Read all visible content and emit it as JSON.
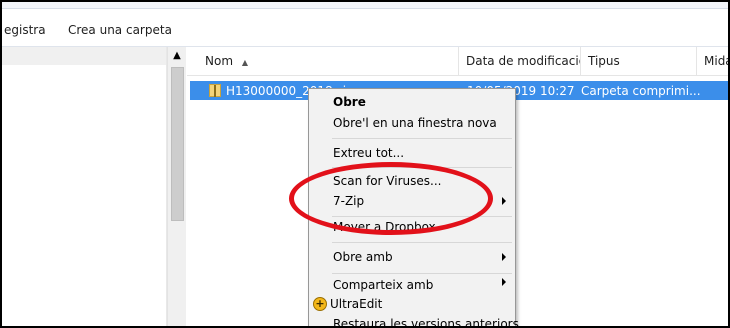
{
  "toolbar": {
    "items": [
      "egistra",
      "Crea una carpeta"
    ]
  },
  "scrollbar": {
    "up_arrow": "▲"
  },
  "columns": {
    "name": "Nom",
    "name_sort_icon": "▲",
    "date": "Data de modificació",
    "type": "Tipus",
    "size": "Mida"
  },
  "file": {
    "name": "H13000000_2018.zip",
    "date": "10/05/2019 10:27",
    "type": "Carpeta comprimi..."
  },
  "context_menu": {
    "open": "Obre",
    "open_new_window": "Obre'l en una finestra nova",
    "extract_all": "Extreu tot...",
    "scan_viruses": "Scan for Viruses...",
    "sevenzip": "7-Zip",
    "dropbox": "Mover a Dropbox",
    "open_with": "Obre amb",
    "share_with": "Comparteix amb",
    "ultraedit": "UltraEdit",
    "restore": "Restaura les versions anteriors"
  },
  "colors": {
    "selection": "#3b8eea",
    "highlight_ellipse": "#e2111a",
    "menu_background": "#f2f2f2"
  }
}
